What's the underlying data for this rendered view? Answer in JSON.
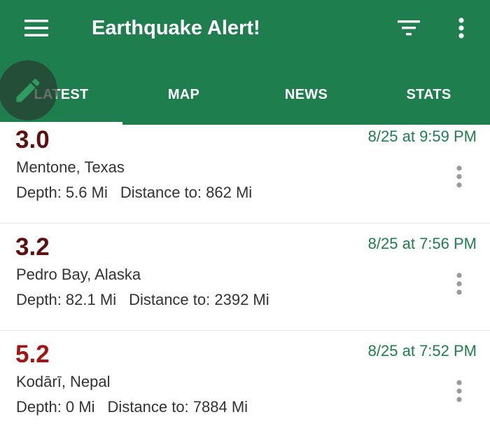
{
  "app": {
    "title": "Earthquake Alert!",
    "accent_color": "#1e7e4e"
  },
  "toolbar": {
    "menu_icon": "hamburger-menu-icon",
    "filter_icon": "filter-icon",
    "more_icon": "more-vertical-icon"
  },
  "tabs": [
    {
      "label": "LATEST",
      "active": true
    },
    {
      "label": "MAP",
      "active": false
    },
    {
      "label": "NEWS",
      "active": false
    },
    {
      "label": "STATS",
      "active": false
    }
  ],
  "fab": {
    "icon": "pencil-icon"
  },
  "quakes": [
    {
      "magnitude": "3.0",
      "magnitude_color": "#5c1010",
      "time": "8/25 at 9:59 PM",
      "place": "Mentone, Texas",
      "depth": "Depth: 5.6 Mi",
      "distance": "Distance to: 862 Mi"
    },
    {
      "magnitude": "3.2",
      "magnitude_color": "#5c1010",
      "time": "8/25 at 7:56 PM",
      "place": "Pedro Bay, Alaska",
      "depth": "Depth: 82.1 Mi",
      "distance": "Distance to: 2392 Mi"
    },
    {
      "magnitude": "5.2",
      "magnitude_color": "#a31515",
      "time": "8/25 at 7:52 PM",
      "place": "Kodārī, Nepal",
      "depth": "Depth: 0 Mi",
      "distance": "Distance to: 7884 Mi"
    }
  ]
}
